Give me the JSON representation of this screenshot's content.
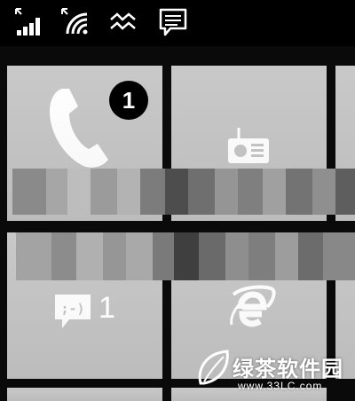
{
  "status_bar": {
    "icons": [
      "signal-strength-icon",
      "wifi-icon",
      "data-connection-icon",
      "notification-message-icon"
    ]
  },
  "tiles": {
    "phone": {
      "icon": "phone-icon",
      "badge": "1",
      "accent": "#c4c4c4"
    },
    "radio": {
      "icon": "radio-icon"
    },
    "messaging": {
      "icon": "messaging-icon",
      "count": "1"
    },
    "internet_explorer": {
      "icon": "internet-explorer-icon"
    }
  },
  "watermark": {
    "brand": "绿茶软件园",
    "url": "www.33LC.com"
  },
  "colors": {
    "background": "#000000",
    "tile": "#c4c4c4",
    "badge": "#000000",
    "icon": "#ffffff"
  }
}
